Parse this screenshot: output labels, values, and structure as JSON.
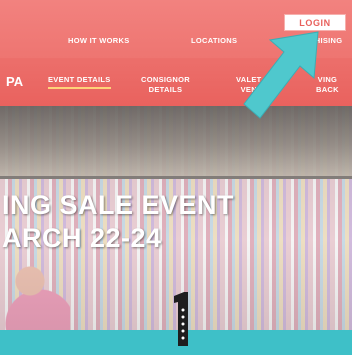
{
  "top_nav": {
    "login_label": "LOGIN",
    "links": [
      "HOW IT WORKS",
      "LOCATIONS",
      "FRANCHISING"
    ]
  },
  "sub_nav": {
    "brand_fragment": "PA",
    "items": [
      {
        "label_line1": "EVENT DETAILS",
        "label_line2": ""
      },
      {
        "label_line1": "CONSIGNOR",
        "label_line2": "DETAILS"
      },
      {
        "label_line1": "VALET",
        "label_line2": "VEN"
      },
      {
        "label_line1": "VING",
        "label_line2": "BACK"
      }
    ]
  },
  "hero": {
    "title_line1": "ING SALE EVENT",
    "title_line2": "ARCH 22-24"
  },
  "marker": {
    "number": "1"
  },
  "colors": {
    "nav_coral": "#ee7571",
    "subnav_coral": "#e9625e",
    "accent_teal": "#3ec0c8",
    "login_text": "#e8605c",
    "active_underline": "#ffd27a"
  }
}
